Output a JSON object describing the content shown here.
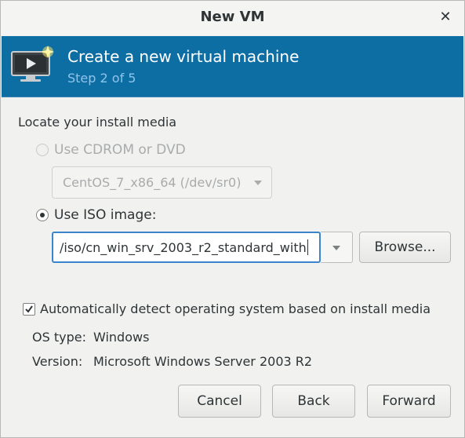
{
  "window": {
    "title": "New VM",
    "close_glyph": "✕"
  },
  "banner": {
    "title": "Create a new virtual machine",
    "step": "Step 2 of 5",
    "icon": "monitor-new-vm-icon",
    "background": "#0d6ea4"
  },
  "install_media": {
    "section_label": "Locate your install media",
    "cdrom_option": {
      "label": "Use CDROM or DVD",
      "selected": false,
      "enabled": false
    },
    "cdrom_device": "CentOS_7_x86_64 (/dev/sr0)",
    "iso_option": {
      "label": "Use ISO image:",
      "selected": true
    },
    "iso_path": "/iso/cn_win_srv_2003_r2_standard_with",
    "browse_label": "Browse..."
  },
  "detect_os": {
    "label": "Automatically detect operating system based on install media",
    "checked": true
  },
  "os_info": {
    "type_label": "OS type:",
    "type_value": "Windows",
    "version_label": "Version:",
    "version_value": "Microsoft Windows Server 2003 R2"
  },
  "footer": {
    "cancel_label": "Cancel",
    "back_label": "Back",
    "forward_label": "Forward"
  }
}
